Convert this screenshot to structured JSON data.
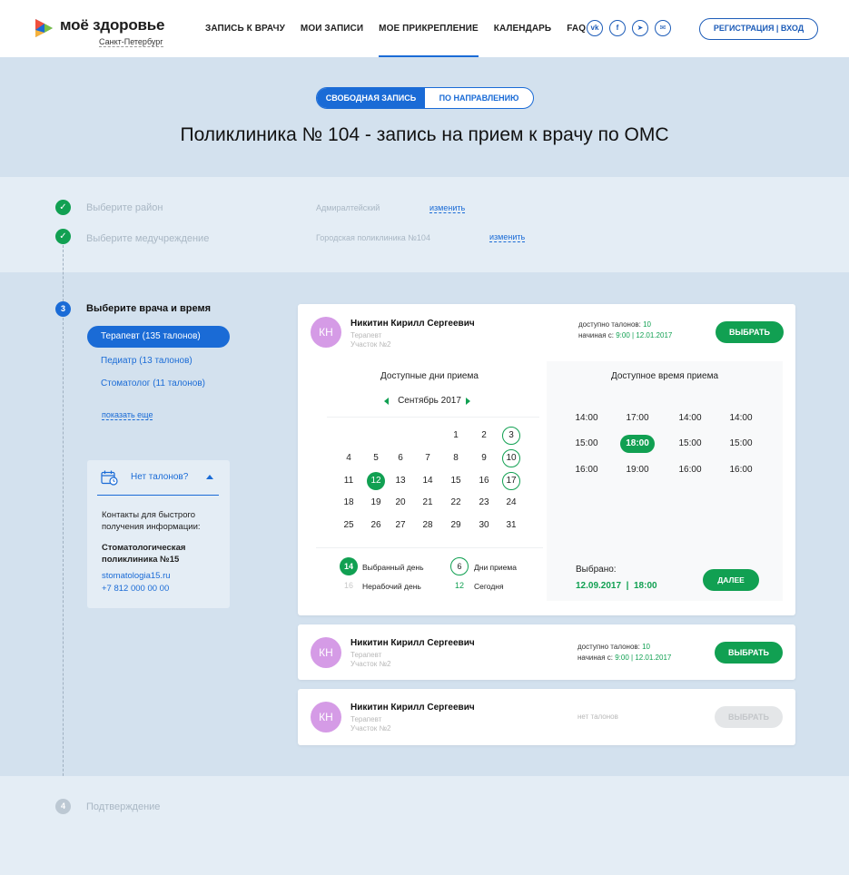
{
  "brand": {
    "name": "моё здоровье",
    "city": "Санкт-Петербург",
    "colors": {
      "blue": "#1a6bd6",
      "green": "#11a052",
      "avatar": "#d59be6"
    }
  },
  "nav": [
    {
      "label": "ЗАПИСЬ К ВРАЧУ"
    },
    {
      "label": "МОИ ЗАПИСИ"
    },
    {
      "label": "МОЕ ПРИКРЕПЛЕНИЕ",
      "active": true
    },
    {
      "label": "КАЛЕНДАРЬ"
    },
    {
      "label": "FAQ"
    }
  ],
  "socials": [
    {
      "icon": "vk-icon",
      "glyph": "vk"
    },
    {
      "icon": "facebook-icon",
      "glyph": "f"
    },
    {
      "icon": "telegram-icon",
      "glyph": "➤"
    },
    {
      "icon": "mail-icon",
      "glyph": "✉"
    }
  ],
  "auth": {
    "label": "РЕГИСТРАЦИЯ  |  ВХОД"
  },
  "mode_toggle": {
    "free": "СВОБОДНАЯ ЗАПИСЬ",
    "referral": "ПО НАПРАВЛЕНИЮ"
  },
  "page_title": "Поликлиника № 104 - запись на прием к врачу по ОМС",
  "steps": {
    "district": {
      "label": "Выберите район",
      "value": "Адмиралтейский",
      "change": "изменить"
    },
    "institution": {
      "label": "Выберите медучреждение",
      "value": "Городская поликлиника №104",
      "change": "изменить"
    },
    "doctor": {
      "number": "3",
      "label": "Выберите врача и время"
    },
    "confirm": {
      "number": "4",
      "label": "Подтверждение"
    }
  },
  "specialties": [
    {
      "label": "Терапевт (135 талонов)",
      "active": true
    },
    {
      "label": "Педиатр (13 талонов)"
    },
    {
      "label": "Стоматолог (11 талонов)"
    }
  ],
  "show_more": "показать еще",
  "no_tickets": {
    "title": "Нет талонов?",
    "contacts_line1": "Контакты для быстрого",
    "contacts_line2": "получения информации:",
    "clinic_line1": "Стоматологическая",
    "clinic_line2": "поликлиника №15",
    "site": "stomatologia15.ru",
    "phone": "+7 812 000 00 00"
  },
  "doctors": [
    {
      "initials": "КН",
      "name": "Никитин Кирилл Сергеевич",
      "specialty": "Терапевт",
      "area": "Участок №2",
      "available_label": "доступно талонов:",
      "available_count": "10",
      "starting_label": "начиная с:",
      "starting_value": "9:00 | 12.01.2017",
      "button": "ВЫБРАТЬ"
    },
    {
      "initials": "КН",
      "name": "Никитин Кирилл Сергеевич",
      "specialty": "Терапевт",
      "area": "Участок №2",
      "available_label": "доступно талонов:",
      "available_count": "10",
      "starting_label": "начиная с:",
      "starting_value": "9:00 | 12.01.2017",
      "button": "ВЫБРАТЬ"
    },
    {
      "initials": "КН",
      "name": "Никитин Кирилл Сергеевич",
      "specialty": "Терапевт",
      "area": "Участок №2",
      "no_tickets": "нет талонов",
      "button": "ВЫБРАТЬ"
    }
  ],
  "calendar": {
    "title": "Доступные дни приема",
    "month": "Сентябрь 2017",
    "days": [
      {
        "d": "1",
        "state": ""
      },
      {
        "d": "2",
        "state": ""
      },
      {
        "d": "3",
        "state": "ring"
      },
      {
        "d": "4",
        "state": ""
      },
      {
        "d": "5",
        "state": ""
      },
      {
        "d": "6",
        "state": ""
      },
      {
        "d": "7",
        "state": ""
      },
      {
        "d": "8",
        "state": ""
      },
      {
        "d": "9",
        "state": ""
      },
      {
        "d": "10",
        "state": "ring"
      },
      {
        "d": "11",
        "state": ""
      },
      {
        "d": "12",
        "state": "sel"
      },
      {
        "d": "13",
        "state": ""
      },
      {
        "d": "14",
        "state": ""
      },
      {
        "d": "15",
        "state": ""
      },
      {
        "d": "16",
        "state": ""
      },
      {
        "d": "17",
        "state": "ring"
      },
      {
        "d": "18",
        "state": ""
      },
      {
        "d": "19",
        "state": ""
      },
      {
        "d": "20",
        "state": ""
      },
      {
        "d": "21",
        "state": ""
      },
      {
        "d": "22",
        "state": ""
      },
      {
        "d": "23",
        "state": ""
      },
      {
        "d": "24",
        "state": ""
      },
      {
        "d": "25",
        "state": ""
      },
      {
        "d": "26",
        "state": ""
      },
      {
        "d": "27",
        "state": ""
      },
      {
        "d": "28",
        "state": ""
      },
      {
        "d": "29",
        "state": ""
      },
      {
        "d": "30",
        "state": ""
      },
      {
        "d": "31",
        "state": ""
      }
    ],
    "legend": {
      "selected_num": "14",
      "selected_label": "Выбранный день",
      "reception_num": "6",
      "reception_label": "Дни приема",
      "nonwork_num": "16",
      "nonwork_label": "Нерабочий день",
      "today_num": "12",
      "today_label": "Сегодня"
    }
  },
  "times": {
    "title": "Доступное время приема",
    "columns": [
      [
        "14:00",
        "15:00",
        "16:00"
      ],
      [
        "17:00",
        "18:00",
        "19:00"
      ],
      [
        "14:00",
        "15:00",
        "16:00"
      ],
      [
        "14:00",
        "15:00",
        "16:00"
      ]
    ],
    "selected": "18:00",
    "chosen_label": "Выбрано:",
    "chosen_date": "12.09.2017",
    "chosen_time": "18:00",
    "next": "ДАЛЕЕ"
  }
}
